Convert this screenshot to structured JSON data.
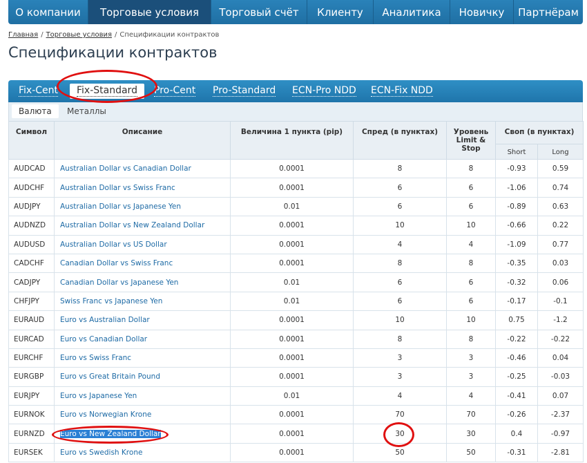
{
  "nav": {
    "items": [
      {
        "label": "О компании",
        "active": false
      },
      {
        "label": "Торговые условия",
        "active": true
      },
      {
        "label": "Торговый счёт",
        "active": false
      },
      {
        "label": "Клиенту",
        "active": false
      },
      {
        "label": "Аналитика",
        "active": false
      },
      {
        "label": "Новичку",
        "active": false
      },
      {
        "label": "Партнёрам",
        "active": false
      }
    ]
  },
  "breadcrumb": {
    "home": "Главная",
    "section": "Торговые условия",
    "current": "Спецификации контрактов",
    "sep": "/"
  },
  "page": {
    "title": "Спецификации контрактов"
  },
  "tabs": {
    "items": [
      {
        "label": "Fix-Cent",
        "active": false
      },
      {
        "label": "Fix-Standard",
        "active": true
      },
      {
        "label": "Pro-Cent",
        "active": false
      },
      {
        "label": "Pro-Standard",
        "active": false
      },
      {
        "label": "ECN-Pro NDD",
        "active": false
      },
      {
        "label": "ECN-Fix NDD",
        "active": false
      }
    ]
  },
  "subtabs": {
    "items": [
      {
        "label": "Валюта",
        "active": true
      },
      {
        "label": "Металлы",
        "active": false
      }
    ]
  },
  "table": {
    "headers": {
      "symbol": "Символ",
      "description": "Описание",
      "pip": "Величина 1 пункта (pip)",
      "spread": "Спред (в пунктах)",
      "level": "Уровень Limit & Stop",
      "swap": "Своп (в пунктах)",
      "short": "Short",
      "long": "Long"
    },
    "rows": [
      {
        "symbol": "AUDCAD",
        "description": "Australian Dollar vs Canadian Dollar",
        "pip": "0.0001",
        "spread": "8",
        "level": "8",
        "short": "-0.93",
        "long": "0.59"
      },
      {
        "symbol": "AUDCHF",
        "description": "Australian Dollar vs Swiss Franc",
        "pip": "0.0001",
        "spread": "6",
        "level": "6",
        "short": "-1.06",
        "long": "0.74"
      },
      {
        "symbol": "AUDJPY",
        "description": "Australian Dollar vs Japanese Yen",
        "pip": "0.01",
        "spread": "6",
        "level": "6",
        "short": "-0.89",
        "long": "0.63"
      },
      {
        "symbol": "AUDNZD",
        "description": "Australian Dollar vs New Zealand Dollar",
        "pip": "0.0001",
        "spread": "10",
        "level": "10",
        "short": "-0.66",
        "long": "0.22"
      },
      {
        "symbol": "AUDUSD",
        "description": "Australian Dollar vs US Dollar",
        "pip": "0.0001",
        "spread": "4",
        "level": "4",
        "short": "-1.09",
        "long": "0.77"
      },
      {
        "symbol": "CADCHF",
        "description": "Canadian Dollar vs Swiss Franc",
        "pip": "0.0001",
        "spread": "8",
        "level": "8",
        "short": "-0.35",
        "long": "0.03"
      },
      {
        "symbol": "CADJPY",
        "description": "Canadian Dollar vs Japanese Yen",
        "pip": "0.01",
        "spread": "6",
        "level": "6",
        "short": "-0.32",
        "long": "0.06"
      },
      {
        "symbol": "CHFJPY",
        "description": "Swiss Franc vs Japanese Yen",
        "pip": "0.01",
        "spread": "6",
        "level": "6",
        "short": "-0.17",
        "long": "-0.1"
      },
      {
        "symbol": "EURAUD",
        "description": "Euro vs Australian Dollar",
        "pip": "0.0001",
        "spread": "10",
        "level": "10",
        "short": "0.75",
        "long": "-1.2"
      },
      {
        "symbol": "EURCAD",
        "description": "Euro vs Canadian Dollar",
        "pip": "0.0001",
        "spread": "8",
        "level": "8",
        "short": "-0.22",
        "long": "-0.22"
      },
      {
        "symbol": "EURCHF",
        "description": "Euro vs Swiss Franc",
        "pip": "0.0001",
        "spread": "3",
        "level": "3",
        "short": "-0.46",
        "long": "0.04"
      },
      {
        "symbol": "EURGBP",
        "description": "Euro vs Great Britain Pound",
        "pip": "0.0001",
        "spread": "3",
        "level": "3",
        "short": "-0.25",
        "long": "-0.03"
      },
      {
        "symbol": "EURJPY",
        "description": "Euro vs Japanese Yen",
        "pip": "0.01",
        "spread": "4",
        "level": "4",
        "short": "-0.41",
        "long": "0.07"
      },
      {
        "symbol": "EURNOK",
        "description": "Euro vs Norwegian Krone",
        "pip": "0.0001",
        "spread": "70",
        "level": "70",
        "short": "-0.26",
        "long": "-2.37"
      },
      {
        "symbol": "EURNZD",
        "description": "Euro vs New Zealand Dollar",
        "pip": "0.0001",
        "spread": "30",
        "level": "30",
        "short": "0.4",
        "long": "-0.97",
        "selected": true
      },
      {
        "symbol": "EURSEK",
        "description": "Euro vs Swedish Krone",
        "pip": "0.0001",
        "spread": "50",
        "level": "50",
        "short": "-0.31",
        "long": "-2.81"
      }
    ]
  },
  "colors": {
    "nav_bg": "#1f6fa3",
    "nav_active": "#1b4f7a",
    "link": "#1d6aa5",
    "annotation": "#e01010",
    "selection": "#2a7fd4"
  }
}
